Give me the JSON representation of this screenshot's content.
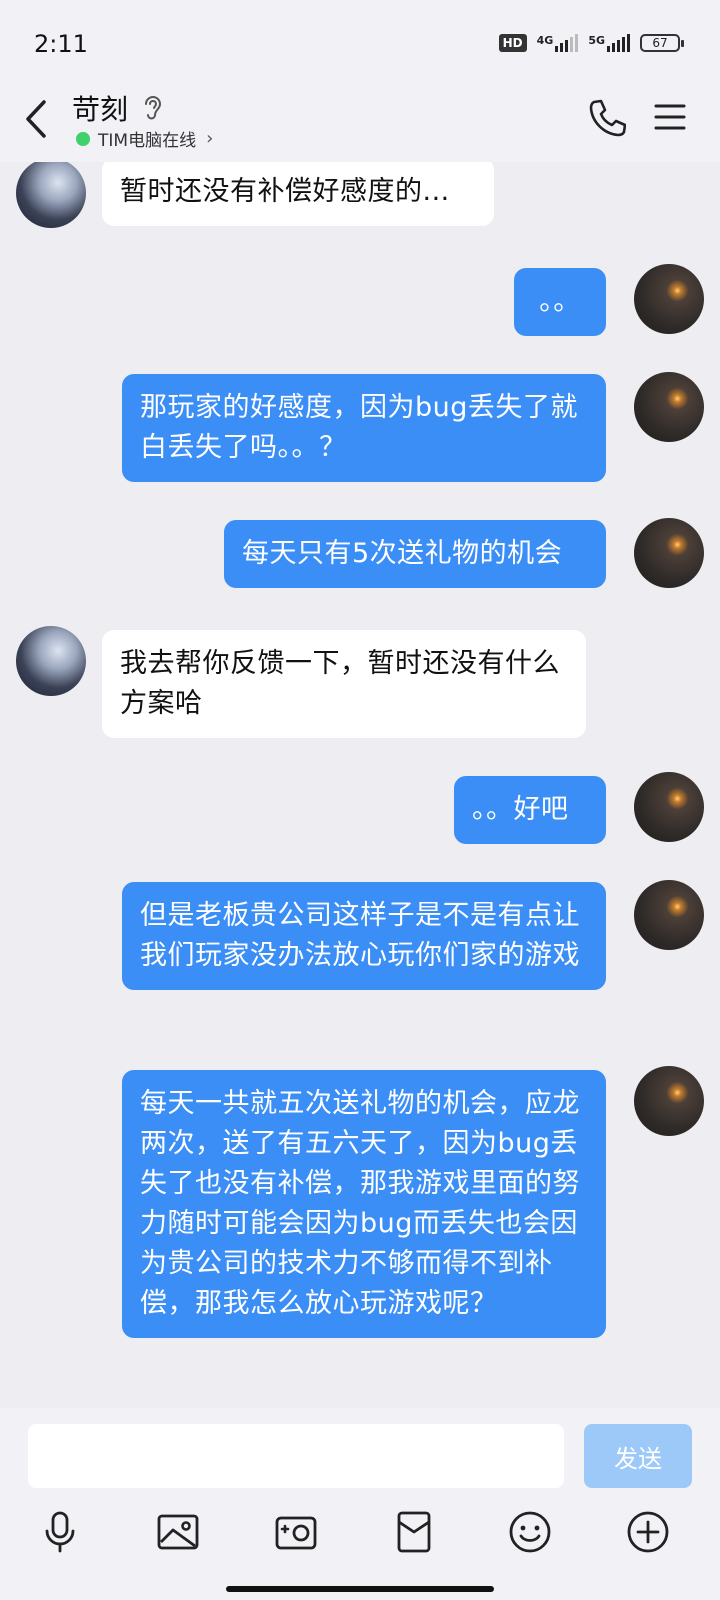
{
  "status_bar": {
    "time": "2:11",
    "hd_badge": "HD",
    "net1": "4G",
    "net2": "5G",
    "battery": "67"
  },
  "header": {
    "contact_name": "苛刻",
    "presence_text": "TIM电脑在线",
    "presence_chevron": "›",
    "icons": [
      "back-arrow-icon",
      "ear-icon",
      "phone-icon",
      "menu-icon"
    ]
  },
  "messages": [
    {
      "from": "them",
      "text": "暂时还没有补偿好感度的..."
    },
    {
      "from": "me",
      "text": "。。"
    },
    {
      "from": "me",
      "text": "那玩家的好感度，因为bug丢失了就白丢失了吗。。？"
    },
    {
      "from": "me",
      "text": "每天只有5次送礼物的机会"
    },
    {
      "from": "them",
      "text": "我去帮你反馈一下，暂时还没有什么方案哈"
    },
    {
      "from": "me",
      "text": "。。好吧"
    },
    {
      "from": "me",
      "text": "但是老板贵公司这样子是不是有点让我们玩家没办法放心玩你们家的游戏"
    },
    {
      "from": "me",
      "text": "每天一共就五次送礼物的机会，应龙两次，送了有五六天了，因为bug丢失了也没有补偿，那我游戏里面的努力随时可能会因为bug而丢失也会因为贵公司的技术力不够而得不到补偿，那我怎么放心玩游戏呢？"
    }
  ],
  "composer": {
    "input_value": "",
    "send_label": "发送",
    "tools": [
      "microphone-icon",
      "image-icon",
      "camera-icon",
      "red-packet-icon",
      "emoji-icon",
      "plus-icon"
    ]
  },
  "colors": {
    "my_bubble": "#3a8ef6",
    "their_bubble": "#ffffff",
    "background": "#ededf2",
    "send_button_disabled": "#9dc9f9",
    "presence_dot": "#3fd16b"
  }
}
